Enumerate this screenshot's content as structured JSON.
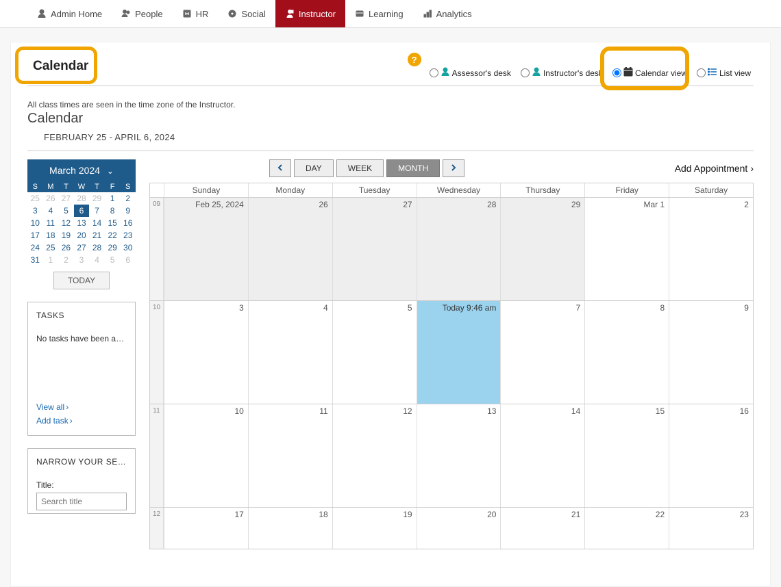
{
  "nav": {
    "items": [
      {
        "label": "Admin Home",
        "icon": "person"
      },
      {
        "label": "People",
        "icon": "people"
      },
      {
        "label": "HR",
        "icon": "hr"
      },
      {
        "label": "Social",
        "icon": "social"
      },
      {
        "label": "Instructor",
        "icon": "instructor",
        "active": true
      },
      {
        "label": "Learning",
        "icon": "learning"
      },
      {
        "label": "Analytics",
        "icon": "analytics"
      }
    ]
  },
  "header": {
    "title": "Calendar",
    "help": "?",
    "views": [
      {
        "id": "assessor",
        "label": "Assessor's desk",
        "icon": "person-teal"
      },
      {
        "id": "instructor",
        "label": "Instructor's desk",
        "icon": "person-teal"
      },
      {
        "id": "calendar",
        "label": "Calendar view",
        "icon": "calendar",
        "selected": true,
        "highlighted": true
      },
      {
        "id": "list",
        "label": "List view",
        "icon": "list"
      }
    ]
  },
  "meta": {
    "note": "All class times are seen in the time zone of the Instructor.",
    "subhead": "Calendar",
    "range": "FEBRUARY 25 - APRIL 6, 2024"
  },
  "mini": {
    "month": "March 2024",
    "dow": [
      "S",
      "M",
      "T",
      "W",
      "T",
      "F",
      "S"
    ],
    "cells": [
      {
        "n": 25,
        "dim": true
      },
      {
        "n": 26,
        "dim": true
      },
      {
        "n": 27,
        "dim": true
      },
      {
        "n": 28,
        "dim": true
      },
      {
        "n": 29,
        "dim": true
      },
      {
        "n": 1
      },
      {
        "n": 2
      },
      {
        "n": 3
      },
      {
        "n": 4
      },
      {
        "n": 5
      },
      {
        "n": 6,
        "sel": true
      },
      {
        "n": 7
      },
      {
        "n": 8
      },
      {
        "n": 9
      },
      {
        "n": 10
      },
      {
        "n": 11
      },
      {
        "n": 12
      },
      {
        "n": 13
      },
      {
        "n": 14
      },
      {
        "n": 15
      },
      {
        "n": 16
      },
      {
        "n": 17
      },
      {
        "n": 18
      },
      {
        "n": 19
      },
      {
        "n": 20
      },
      {
        "n": 21
      },
      {
        "n": 22
      },
      {
        "n": 23
      },
      {
        "n": 24
      },
      {
        "n": 25
      },
      {
        "n": 26
      },
      {
        "n": 27
      },
      {
        "n": 28
      },
      {
        "n": 29
      },
      {
        "n": 30
      },
      {
        "n": 31
      },
      {
        "n": 1,
        "dim": true
      },
      {
        "n": 2,
        "dim": true
      },
      {
        "n": 3,
        "dim": true
      },
      {
        "n": 4,
        "dim": true
      },
      {
        "n": 5,
        "dim": true
      },
      {
        "n": 6,
        "dim": true
      }
    ],
    "today": "TODAY"
  },
  "tasks": {
    "title": "TASKS",
    "empty": "No tasks have been add…",
    "view_all": "View all",
    "add": "Add task"
  },
  "narrow": {
    "title": "NARROW YOUR SE…",
    "title_label": "Title:",
    "placeholder": "Search title"
  },
  "toolbar": {
    "prev": "prev",
    "next": "next",
    "day": "DAY",
    "week": "WEEK",
    "month": "MONTH",
    "add": "Add Appointment"
  },
  "big": {
    "dow": [
      "Sunday",
      "Monday",
      "Tuesday",
      "Wednesday",
      "Thursday",
      "Friday",
      "Saturday"
    ],
    "weeks": [
      {
        "wk": "09",
        "cells": [
          {
            "label": "Feb 25, 2024",
            "dim": true
          },
          {
            "label": "26",
            "dim": true
          },
          {
            "label": "27",
            "dim": true
          },
          {
            "label": "28",
            "dim": true
          },
          {
            "label": "29",
            "dim": true
          },
          {
            "label": "Mar 1"
          },
          {
            "label": "2"
          }
        ]
      },
      {
        "wk": "10",
        "cells": [
          {
            "label": "3"
          },
          {
            "label": "4"
          },
          {
            "label": "5"
          },
          {
            "label": "Today 9:46 am",
            "today": true
          },
          {
            "label": "7"
          },
          {
            "label": "8"
          },
          {
            "label": "9"
          }
        ]
      },
      {
        "wk": "11",
        "cells": [
          {
            "label": "10"
          },
          {
            "label": "11"
          },
          {
            "label": "12"
          },
          {
            "label": "13"
          },
          {
            "label": "14"
          },
          {
            "label": "15"
          },
          {
            "label": "16"
          }
        ]
      },
      {
        "wk": "12",
        "short": true,
        "cells": [
          {
            "label": "17"
          },
          {
            "label": "18"
          },
          {
            "label": "19"
          },
          {
            "label": "20"
          },
          {
            "label": "21"
          },
          {
            "label": "22"
          },
          {
            "label": "23"
          }
        ]
      }
    ]
  }
}
